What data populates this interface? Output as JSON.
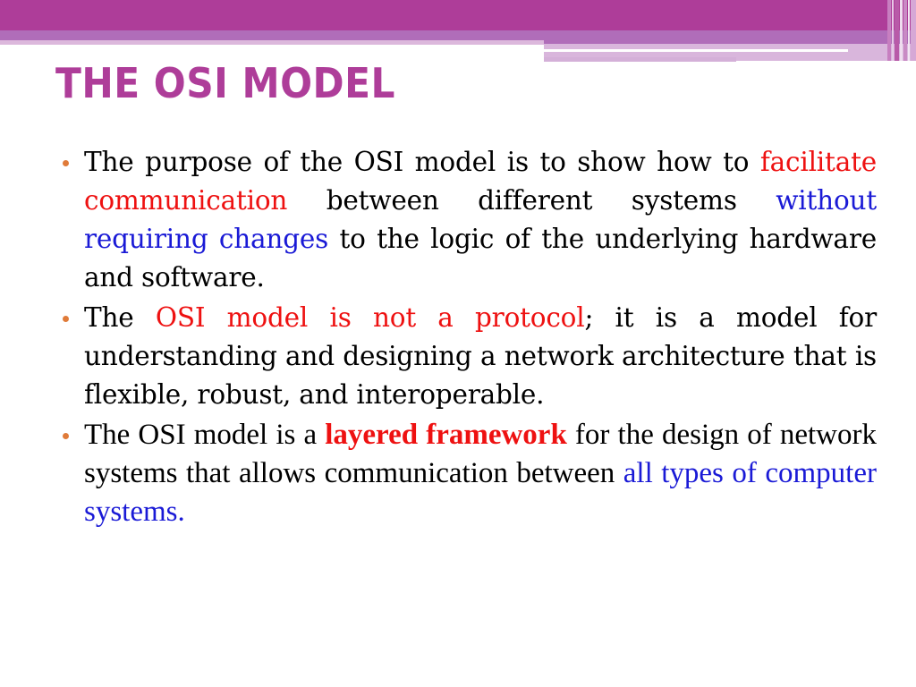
{
  "slide": {
    "title": "THE OSI MODEL",
    "colors": {
      "accent": "#ae3d99",
      "band_secondary": "#b06db9",
      "band_light": "#dcb8dc",
      "bullet": "#e07b39",
      "highlight_red": "#ee1111",
      "highlight_blue": "#1a1ad6",
      "text": "#000000"
    },
    "bullets": [
      {
        "segments": [
          {
            "text": "The purpose of the OSI model is to show how to ",
            "style": "normal"
          },
          {
            "text": "facilitate communication",
            "style": "red"
          },
          {
            "text": " between different systems ",
            "style": "normal"
          },
          {
            "text": "without requiring changes",
            "style": "blue"
          },
          {
            "text": " to the logic of the underlying hardware and software.",
            "style": "normal"
          }
        ]
      },
      {
        "segments": [
          {
            "text": "The ",
            "style": "normal"
          },
          {
            "text": "OSI model is not a protocol",
            "style": "red"
          },
          {
            "text": "; it is a model for understanding and designing a network architecture that is flexible, robust, and interoperable.",
            "style": "normal"
          }
        ]
      },
      {
        "segments": [
          {
            "text": "The OSI model is a ",
            "style": "normal"
          },
          {
            "text": "layered framework",
            "style": "red-bold"
          },
          {
            "text": " for the design of network systems that allows communication between ",
            "style": "normal"
          },
          {
            "text": "all types of computer systems.",
            "style": "blue"
          }
        ]
      }
    ]
  }
}
